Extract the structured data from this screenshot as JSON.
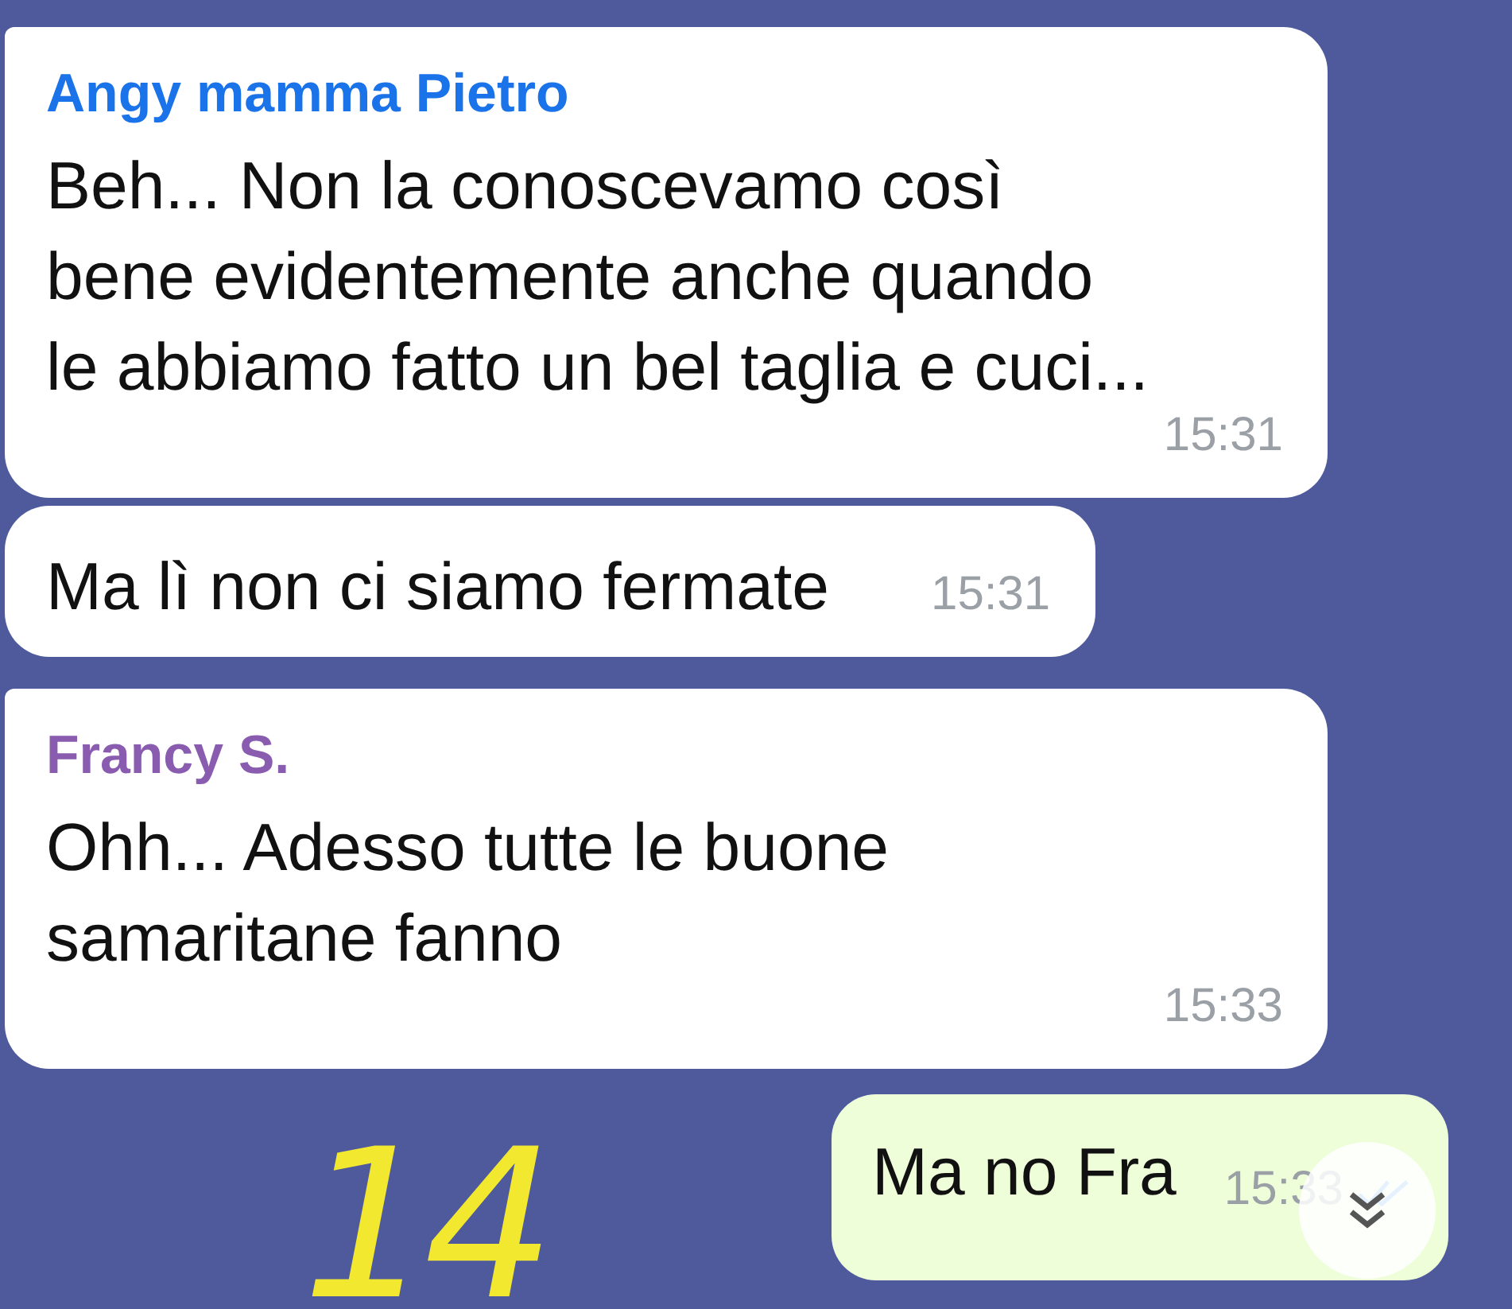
{
  "messages": [
    {
      "outgoing": false,
      "sender": "Angy mamma Pietro",
      "color": "#1a73e8",
      "text": "Beh... Non la conoscevamo così bene evidentemente anche quando le abbiamo fatto un bel taglia e cuci...",
      "time": "15:31",
      "tail": true
    },
    {
      "outgoing": false,
      "text": "Ma lì non ci siamo fermate",
      "time": "15:31",
      "tail": false
    },
    {
      "outgoing": false,
      "sender": "Francy S.",
      "color": "#8a5cb0",
      "text": "Ohh... Adesso tutte le buone samaritane fanno",
      "time": "15:33",
      "tail": true
    },
    {
      "outgoing": true,
      "text": "Ma no Fra",
      "time": "15:33",
      "read": true
    }
  ],
  "annotation": "14",
  "scroll_down_button": true
}
